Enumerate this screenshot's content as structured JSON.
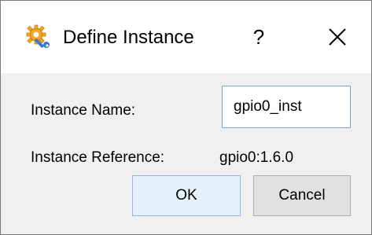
{
  "window": {
    "title": "Define Instance",
    "help_label": "?",
    "icon": "wrench-gear-icon",
    "close_icon": "close-icon"
  },
  "form": {
    "instance_name_label": "Instance Name:",
    "instance_name_value": "gpio0_inst",
    "instance_reference_label": "Instance Reference:",
    "instance_reference_value": "gpio0:1.6.0"
  },
  "buttons": {
    "ok_label": "OK",
    "cancel_label": "Cancel"
  },
  "colors": {
    "icon_primary": "#f5a623",
    "icon_secondary": "#3a78c8",
    "focus_border": "#7aa7d8",
    "dialog_bg": "#f0f0f0"
  }
}
